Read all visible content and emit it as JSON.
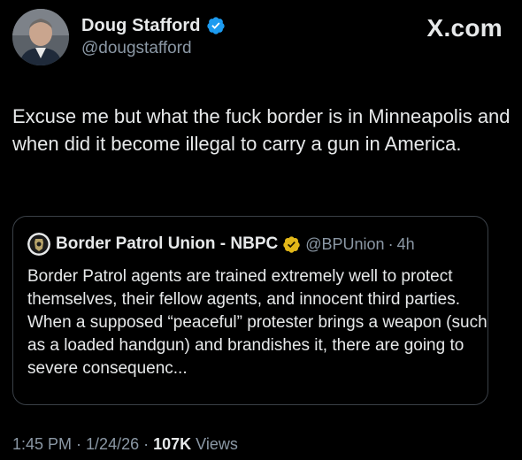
{
  "author": {
    "display_name": "Doug Stafford",
    "handle": "@dougstafford",
    "verified_icon": "blue-verified-badge-icon"
  },
  "brand": {
    "label": "X.com"
  },
  "tweet": {
    "text": "Excuse me but what the fuck border is in Minneapolis and when did it become illegal to carry a gun in America."
  },
  "quoted_tweet": {
    "display_name": "Border Patrol Union - NBPC",
    "handle": "@BPUnion",
    "separator": "·",
    "time": "4h",
    "badge_icon": "gold-verified-badge-icon",
    "text": "Border Patrol agents are trained extremely well to protect themselves, their fellow agents, and innocent third parties. When a supposed “peaceful” protester brings a weapon (such as a loaded handgun) and brandishes it, there are going to severe consequenc..."
  },
  "meta": {
    "time": "1:45 PM",
    "separator": "·",
    "date": "1/24/26",
    "views_count": "107K",
    "views_label": "Views"
  },
  "colors": {
    "background": "#000000",
    "primary_text": "#e7e9ea",
    "secondary_text": "#8b98a5",
    "verified_blue": "#1d9bf0",
    "verified_gold": "#e2b719",
    "border": "#3a4047"
  }
}
